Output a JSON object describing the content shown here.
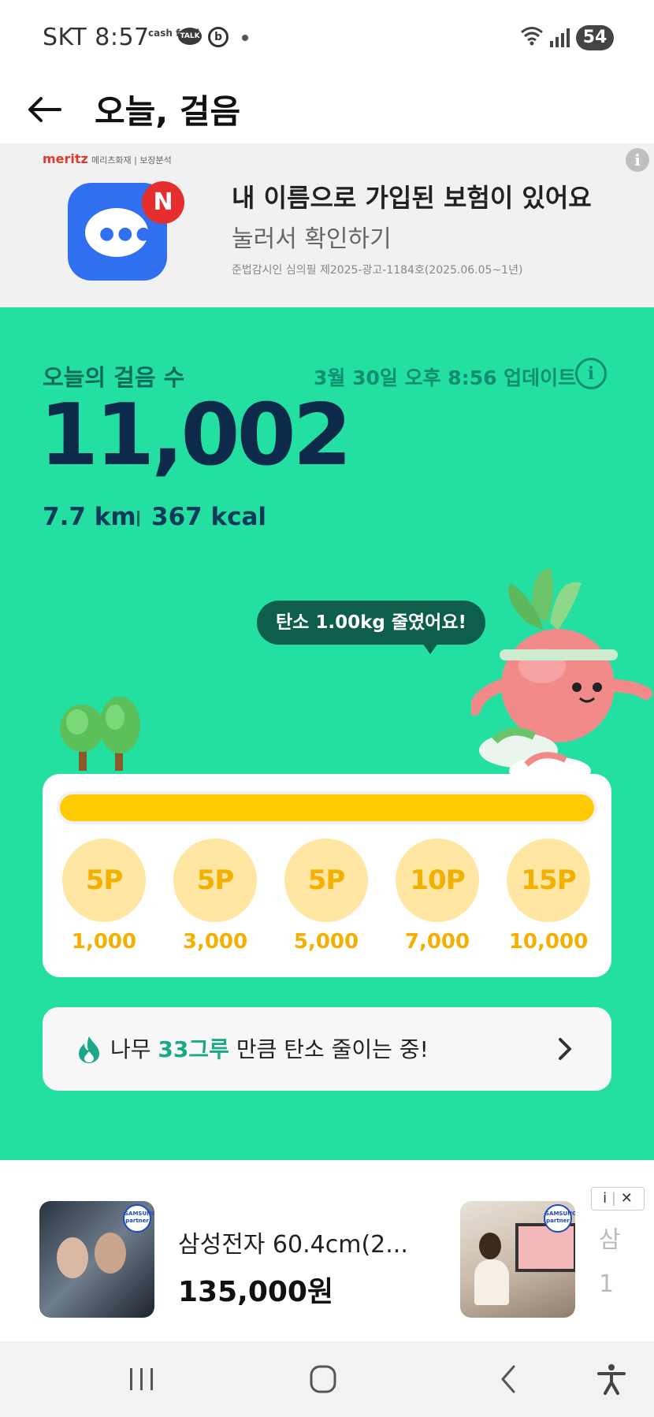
{
  "status_bar": {
    "carrier": "SKT",
    "time": "8:57",
    "cashfeed_label": "cash feed",
    "talk_label": "TALK",
    "battery": "54"
  },
  "header": {
    "title": "오늘, 걸음"
  },
  "ad_banner": {
    "brand": "meritz",
    "brand_sub": "메리츠화재 | 보장분석",
    "badge": "N",
    "title": "내 이름으로 가입된 보험이 있어요",
    "subtitle": "눌러서 확인하기",
    "legal": "준법감시인 심의필 제2025-광고-1184호(2025.06.05~1년)",
    "info": "i"
  },
  "steps": {
    "label": "오늘의 걸음 수",
    "updated": "3월 30일 오후 8:56 업데이트",
    "info": "i",
    "count": "11,002",
    "distance": "7.7 km",
    "calories": "367 kcal"
  },
  "carbon_bubble": "탄소 1.00kg 줄였어요!",
  "progress": {
    "fraction": 1.0
  },
  "milestones": [
    {
      "points": "5P",
      "steps": "1,000"
    },
    {
      "points": "5P",
      "steps": "3,000"
    },
    {
      "points": "5P",
      "steps": "5,000"
    },
    {
      "points": "10P",
      "steps": "7,000"
    },
    {
      "points": "15P",
      "steps": "10,000"
    }
  ],
  "tree_card": {
    "prefix": "나무 ",
    "highlight": "33그루",
    "suffix": " 만큼 탄소 줄이는 중!"
  },
  "product_ad": {
    "badge": "삼성전자 공식파트너",
    "name": "삼성전자 60.4cm(2...",
    "price": "135,000원",
    "next_name": "삼",
    "next_price": "1",
    "info": "i",
    "close": "✕"
  },
  "colors": {
    "green_bg": "#23dfa1",
    "yellow": "#ffcb00",
    "dark_navy": "#0e2a4a"
  }
}
